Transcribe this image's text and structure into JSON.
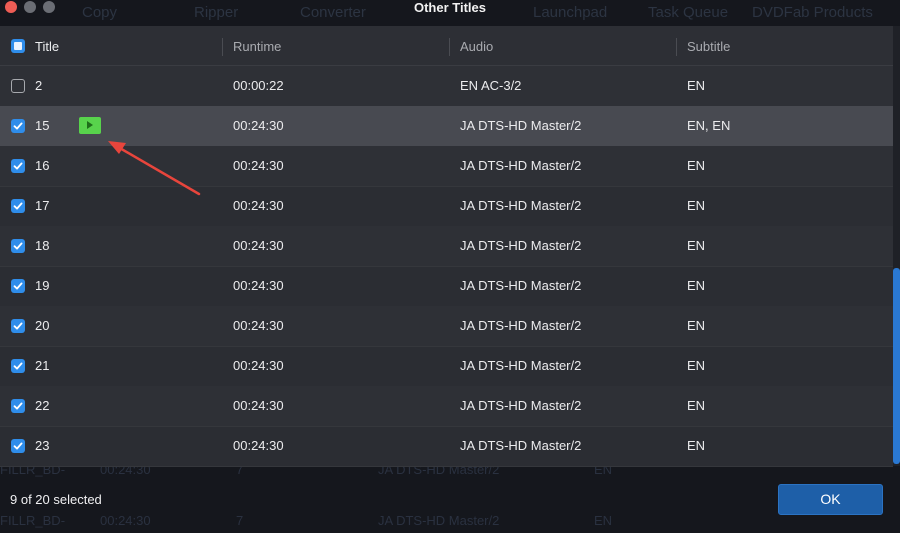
{
  "window": {
    "title": "Other Titles"
  },
  "background_menu": [
    "Copy",
    "Ripper",
    "Converter",
    "Launchpad",
    "Task Queue",
    "DVDFab Products"
  ],
  "background_rows": [
    {
      "name": "FILLR_BD-",
      "time": "00:24:30",
      "num": "7",
      "audio": "JA  DTS-HD Master/2",
      "sub": "EN"
    },
    {
      "name": "FILLR_BD-",
      "time": "00:24:30",
      "num": "7",
      "audio": "JA  DTS-HD Master/2",
      "sub": "EN"
    }
  ],
  "table": {
    "columns": [
      "Title",
      "Runtime",
      "Audio",
      "Subtitle"
    ],
    "header_checkbox": "partial",
    "rows": [
      {
        "checked": false,
        "title": "2",
        "runtime": "00:00:22",
        "audio": "EN  AC-3/2",
        "subtitle": "EN"
      },
      {
        "checked": true,
        "title": "15",
        "runtime": "00:24:30",
        "audio": "JA  DTS-HD Master/2",
        "subtitle": "EN, EN",
        "selected": true,
        "play_icon": "play-icon"
      },
      {
        "checked": true,
        "title": "16",
        "runtime": "00:24:30",
        "audio": "JA  DTS-HD Master/2",
        "subtitle": "EN"
      },
      {
        "checked": true,
        "title": "17",
        "runtime": "00:24:30",
        "audio": "JA  DTS-HD Master/2",
        "subtitle": "EN"
      },
      {
        "checked": true,
        "title": "18",
        "runtime": "00:24:30",
        "audio": "JA  DTS-HD Master/2",
        "subtitle": "EN"
      },
      {
        "checked": true,
        "title": "19",
        "runtime": "00:24:30",
        "audio": "JA  DTS-HD Master/2",
        "subtitle": "EN"
      },
      {
        "checked": true,
        "title": "20",
        "runtime": "00:24:30",
        "audio": "JA  DTS-HD Master/2",
        "subtitle": "EN"
      },
      {
        "checked": true,
        "title": "21",
        "runtime": "00:24:30",
        "audio": "JA  DTS-HD Master/2",
        "subtitle": "EN"
      },
      {
        "checked": true,
        "title": "22",
        "runtime": "00:24:30",
        "audio": "JA  DTS-HD Master/2",
        "subtitle": "EN"
      },
      {
        "checked": true,
        "title": "23",
        "runtime": "00:24:30",
        "audio": "JA  DTS-HD Master/2",
        "subtitle": "EN"
      }
    ]
  },
  "footer": {
    "status": "9 of 20 selected",
    "ok_label": "OK"
  },
  "colors": {
    "accent": "#2f8dea",
    "ok_button": "#1e5fa8",
    "play_button": "#58d34c",
    "annotation_arrow": "#e8453c"
  }
}
